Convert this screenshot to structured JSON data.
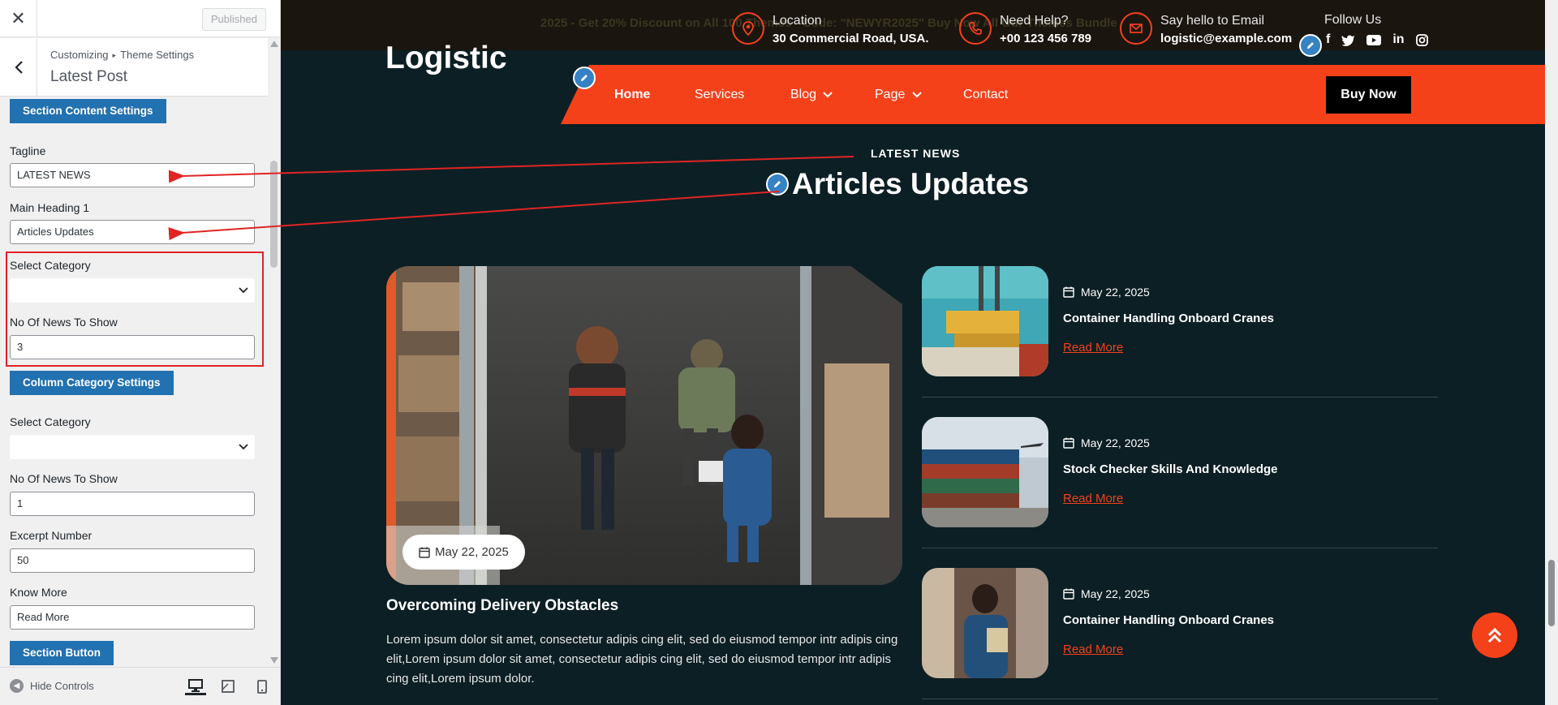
{
  "customizer": {
    "close_icon": "close-icon",
    "published_label": "Published",
    "breadcrumb_root": "Customizing",
    "breadcrumb_sep": "▸",
    "breadcrumb_section": "Theme Settings",
    "panel_title": "Latest Post",
    "section_content_btn": "Section Content Settings",
    "tagline_label": "Tagline",
    "tagline_value": "LATEST NEWS",
    "heading_label": "Main Heading 1",
    "heading_value": "Articles Updates",
    "select_category_label": "Select Category",
    "news_count_label": "No Of News To Show",
    "news_count_value": "3",
    "column_category_btn": "Column Category Settings",
    "select_category2_label": "Select Category",
    "news_count2_label": "No Of News To Show",
    "news_count2_value": "1",
    "excerpt_label": "Excerpt Number",
    "excerpt_value": "50",
    "know_more_label": "Know More",
    "know_more_value": "Read More",
    "section_button_btn": "Section Button",
    "hide_controls_label": "Hide Controls"
  },
  "site": {
    "promo_text": "2025 - Get 20% Discount on All 100 Themes - Code: \"NEWYR2025\"   Buy Now   All Our Themes Bundle",
    "location_title": "Location",
    "location_value": "30 Commercial Road, USA.",
    "help_title": "Need Help?",
    "help_value": "+00 123 456 789",
    "email_title": "Say hello to Email",
    "email_value": "logistic@example.com",
    "follow_title": "Follow Us",
    "socials": [
      "f",
      "twitter-icon",
      "youtube-icon",
      "in",
      "instagram-icon"
    ],
    "logo": "Logistic",
    "nav": [
      "Home",
      "Services",
      "Blog",
      "Page",
      "Contact"
    ],
    "buy_now": "Buy Now",
    "tagline": "LATEST NEWS",
    "heading": "Articles Updates",
    "main_post": {
      "date": "May 22, 2025",
      "title": "Overcoming Delivery Obstacles",
      "excerpt": "Lorem ipsum dolor sit amet, consectetur adipis cing elit, sed do eiusmod tempor intr adipis cing elit,Lorem ipsum dolor sit amet, consectetur adipis cing elit, sed do eiusmod tempor intr adipis cing elit,Lorem ipsum dolor."
    },
    "side_posts": [
      {
        "date": "May 22, 2025",
        "title": "Container Handling Onboard Cranes",
        "link": "Read More"
      },
      {
        "date": "May 22, 2025",
        "title": "Stock Checker Skills And Knowledge",
        "link": "Read More"
      },
      {
        "date": "May 22, 2025",
        "title": "Container Handling Onboard Cranes",
        "link": "Read More"
      }
    ]
  },
  "colors": {
    "accent": "#f5411a",
    "wp_blue": "#2271b1",
    "dark_bg": "#0c1f24",
    "annotation_red": "#e02424"
  }
}
